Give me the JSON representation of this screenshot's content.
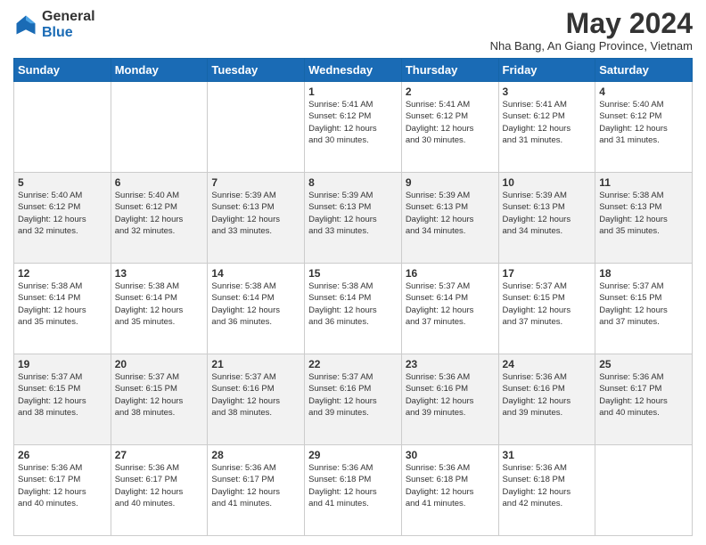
{
  "header": {
    "logo_general": "General",
    "logo_blue": "Blue",
    "month_title": "May 2024",
    "location": "Nha Bang, An Giang Province, Vietnam"
  },
  "weekdays": [
    "Sunday",
    "Monday",
    "Tuesday",
    "Wednesday",
    "Thursday",
    "Friday",
    "Saturday"
  ],
  "weeks": [
    [
      {
        "day": "",
        "info": ""
      },
      {
        "day": "",
        "info": ""
      },
      {
        "day": "",
        "info": ""
      },
      {
        "day": "1",
        "info": "Sunrise: 5:41 AM\nSunset: 6:12 PM\nDaylight: 12 hours\nand 30 minutes."
      },
      {
        "day": "2",
        "info": "Sunrise: 5:41 AM\nSunset: 6:12 PM\nDaylight: 12 hours\nand 30 minutes."
      },
      {
        "day": "3",
        "info": "Sunrise: 5:41 AM\nSunset: 6:12 PM\nDaylight: 12 hours\nand 31 minutes."
      },
      {
        "day": "4",
        "info": "Sunrise: 5:40 AM\nSunset: 6:12 PM\nDaylight: 12 hours\nand 31 minutes."
      }
    ],
    [
      {
        "day": "5",
        "info": "Sunrise: 5:40 AM\nSunset: 6:12 PM\nDaylight: 12 hours\nand 32 minutes."
      },
      {
        "day": "6",
        "info": "Sunrise: 5:40 AM\nSunset: 6:12 PM\nDaylight: 12 hours\nand 32 minutes."
      },
      {
        "day": "7",
        "info": "Sunrise: 5:39 AM\nSunset: 6:13 PM\nDaylight: 12 hours\nand 33 minutes."
      },
      {
        "day": "8",
        "info": "Sunrise: 5:39 AM\nSunset: 6:13 PM\nDaylight: 12 hours\nand 33 minutes."
      },
      {
        "day": "9",
        "info": "Sunrise: 5:39 AM\nSunset: 6:13 PM\nDaylight: 12 hours\nand 34 minutes."
      },
      {
        "day": "10",
        "info": "Sunrise: 5:39 AM\nSunset: 6:13 PM\nDaylight: 12 hours\nand 34 minutes."
      },
      {
        "day": "11",
        "info": "Sunrise: 5:38 AM\nSunset: 6:13 PM\nDaylight: 12 hours\nand 35 minutes."
      }
    ],
    [
      {
        "day": "12",
        "info": "Sunrise: 5:38 AM\nSunset: 6:14 PM\nDaylight: 12 hours\nand 35 minutes."
      },
      {
        "day": "13",
        "info": "Sunrise: 5:38 AM\nSunset: 6:14 PM\nDaylight: 12 hours\nand 35 minutes."
      },
      {
        "day": "14",
        "info": "Sunrise: 5:38 AM\nSunset: 6:14 PM\nDaylight: 12 hours\nand 36 minutes."
      },
      {
        "day": "15",
        "info": "Sunrise: 5:38 AM\nSunset: 6:14 PM\nDaylight: 12 hours\nand 36 minutes."
      },
      {
        "day": "16",
        "info": "Sunrise: 5:37 AM\nSunset: 6:14 PM\nDaylight: 12 hours\nand 37 minutes."
      },
      {
        "day": "17",
        "info": "Sunrise: 5:37 AM\nSunset: 6:15 PM\nDaylight: 12 hours\nand 37 minutes."
      },
      {
        "day": "18",
        "info": "Sunrise: 5:37 AM\nSunset: 6:15 PM\nDaylight: 12 hours\nand 37 minutes."
      }
    ],
    [
      {
        "day": "19",
        "info": "Sunrise: 5:37 AM\nSunset: 6:15 PM\nDaylight: 12 hours\nand 38 minutes."
      },
      {
        "day": "20",
        "info": "Sunrise: 5:37 AM\nSunset: 6:15 PM\nDaylight: 12 hours\nand 38 minutes."
      },
      {
        "day": "21",
        "info": "Sunrise: 5:37 AM\nSunset: 6:16 PM\nDaylight: 12 hours\nand 38 minutes."
      },
      {
        "day": "22",
        "info": "Sunrise: 5:37 AM\nSunset: 6:16 PM\nDaylight: 12 hours\nand 39 minutes."
      },
      {
        "day": "23",
        "info": "Sunrise: 5:36 AM\nSunset: 6:16 PM\nDaylight: 12 hours\nand 39 minutes."
      },
      {
        "day": "24",
        "info": "Sunrise: 5:36 AM\nSunset: 6:16 PM\nDaylight: 12 hours\nand 39 minutes."
      },
      {
        "day": "25",
        "info": "Sunrise: 5:36 AM\nSunset: 6:17 PM\nDaylight: 12 hours\nand 40 minutes."
      }
    ],
    [
      {
        "day": "26",
        "info": "Sunrise: 5:36 AM\nSunset: 6:17 PM\nDaylight: 12 hours\nand 40 minutes."
      },
      {
        "day": "27",
        "info": "Sunrise: 5:36 AM\nSunset: 6:17 PM\nDaylight: 12 hours\nand 40 minutes."
      },
      {
        "day": "28",
        "info": "Sunrise: 5:36 AM\nSunset: 6:17 PM\nDaylight: 12 hours\nand 41 minutes."
      },
      {
        "day": "29",
        "info": "Sunrise: 5:36 AM\nSunset: 6:18 PM\nDaylight: 12 hours\nand 41 minutes."
      },
      {
        "day": "30",
        "info": "Sunrise: 5:36 AM\nSunset: 6:18 PM\nDaylight: 12 hours\nand 41 minutes."
      },
      {
        "day": "31",
        "info": "Sunrise: 5:36 AM\nSunset: 6:18 PM\nDaylight: 12 hours\nand 42 minutes."
      },
      {
        "day": "",
        "info": ""
      }
    ]
  ]
}
